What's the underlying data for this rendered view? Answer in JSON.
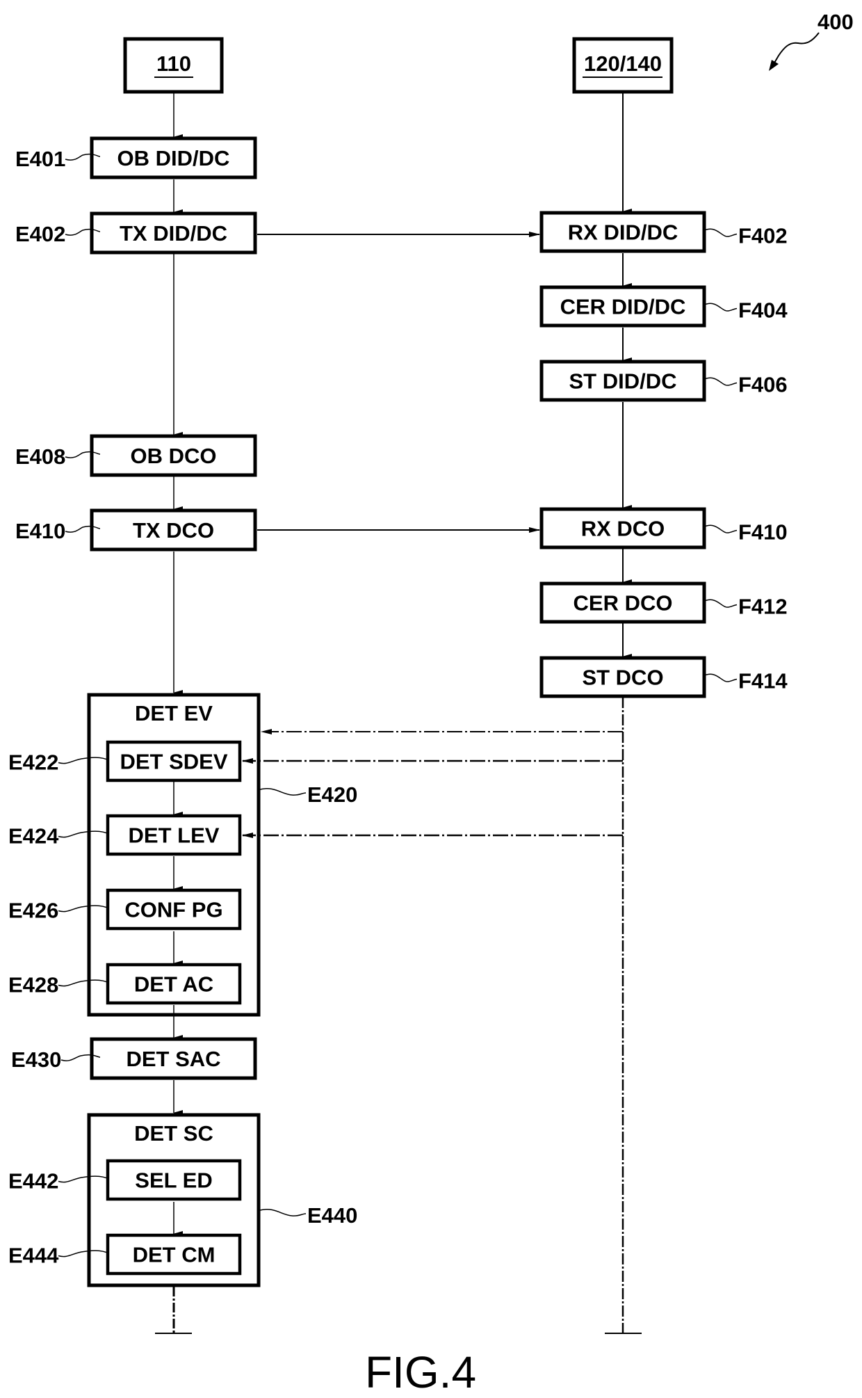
{
  "figure": {
    "number": "400",
    "caption": "FIG.4"
  },
  "entities": {
    "left": {
      "label": "110",
      "underlined": true
    },
    "right": {
      "label": "120/140",
      "underlined": true
    }
  },
  "left_steps": [
    {
      "id": "E401",
      "label": "OB DID/DC"
    },
    {
      "id": "E402",
      "label": "TX DID/DC"
    },
    {
      "id": "E408",
      "label": "OB DCO"
    },
    {
      "id": "E410",
      "label": "TX DCO"
    }
  ],
  "right_steps": [
    {
      "id": "F402",
      "label": "RX DID/DC"
    },
    {
      "id": "F404",
      "label": "CER DID/DC"
    },
    {
      "id": "F406",
      "label": "ST DID/DC"
    },
    {
      "id": "F410",
      "label": "RX DCO"
    },
    {
      "id": "F412",
      "label": "CER DCO"
    },
    {
      "id": "F414",
      "label": "ST DCO"
    }
  ],
  "group_ev": {
    "id": "E420",
    "title": "DET EV",
    "steps": [
      {
        "id": "E422",
        "label": "DET SDEV"
      },
      {
        "id": "E424",
        "label": "DET LEV"
      },
      {
        "id": "E426",
        "label": "CONF PG"
      },
      {
        "id": "E428",
        "label": "DET AC"
      }
    ]
  },
  "step_sac": {
    "id": "E430",
    "label": "DET SAC"
  },
  "group_sc": {
    "id": "E440",
    "title": "DET SC",
    "steps": [
      {
        "id": "E442",
        "label": "SEL ED"
      },
      {
        "id": "E444",
        "label": "DET CM"
      }
    ]
  },
  "messages": [
    {
      "from": "E402",
      "to": "F402",
      "style": "solid"
    },
    {
      "from": "E410",
      "to": "F410",
      "style": "solid"
    },
    {
      "from": "right-lifeline",
      "to": "E420",
      "style": "dash-dot"
    },
    {
      "from": "right-lifeline",
      "to": "E422",
      "style": "dash-dot"
    },
    {
      "from": "right-lifeline",
      "to": "E424",
      "style": "dash-dot"
    }
  ]
}
